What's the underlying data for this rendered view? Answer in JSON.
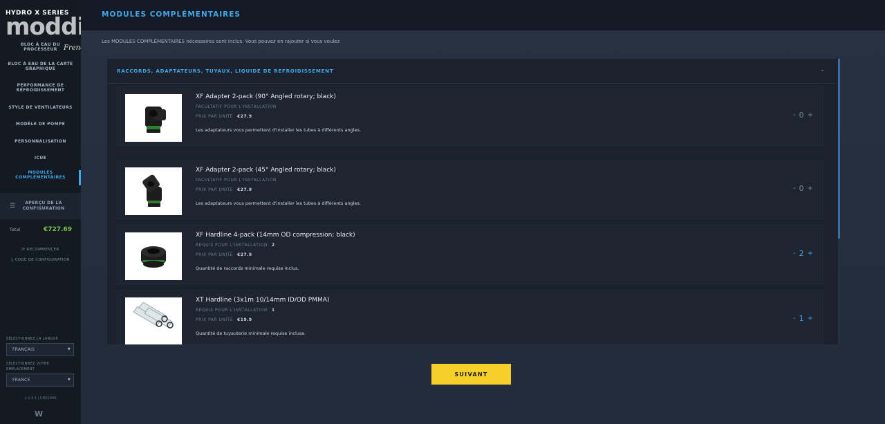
{
  "brand": {
    "name": "HYDRO X SERIES",
    "watermark": "modding.fr",
    "watermark_sub": "French touch"
  },
  "sidebar": {
    "items": [
      {
        "label": "BLOC À EAU DU PROCESSEUR"
      },
      {
        "label": "BLOC À EAU DE LA CARTE GRAPHIQUE"
      },
      {
        "label": "PERFORMANCE DE REFROIDISSEMENT"
      },
      {
        "label": "STYLE DE VENTILATEURS"
      },
      {
        "label": "MODÈLE DE POMPE"
      },
      {
        "label": "PERSONNALISATION"
      },
      {
        "label": "ICUE"
      },
      {
        "label": "MODULES COMPLÉMENTAIRES"
      }
    ],
    "overview_label": "APERÇU DE LA CONFIGURATION",
    "total_label": "Total",
    "total_value": "€727.69",
    "restart_label": "RECOMMENCER",
    "config_code_label": "CODE DE CONFIGURATION",
    "language_label": "SÉLECTIONNEZ LA LANGUE",
    "language_value": "FRANÇAIS",
    "location_label": "SÉLECTIONNEZ VOTRE EMPLACEMENT",
    "location_value": "FRANCE",
    "version": "v 1.3.1 | CHX1930"
  },
  "header": {
    "title": "MODULES COMPLÉMENTAIRES"
  },
  "main": {
    "intro": "Les MODULES COMPLÉMENTAIRES nécessaires sont inclus. Vous pouvez en rajouter si vous voulez",
    "panel_title": "RACCORDS, ADAPTATEURS, TUYAUX, LIQUIDE DE REFROIDISSEMENT",
    "products": [
      {
        "name": "XF Adapter 2-pack (90° Angled rotary; black)",
        "requirement": "FACULTATIF POUR L'INSTALLATION",
        "requirement_count": "",
        "price_label": "PRIX PAR UNITÉ",
        "price": "€27.9",
        "description": "Les adaptateurs vous permettent d'installer les tubes à différents angles.",
        "qty": "0",
        "required": false,
        "icon": "adapter-90-icon"
      },
      {
        "name": "XF Adapter 2-pack (45° Angled rotary; black)",
        "requirement": "FACULTATIF POUR L'INSTALLATION",
        "requirement_count": "",
        "price_label": "PRIX PAR UNITÉ",
        "price": "€27.9",
        "description": "Les adaptateurs vous permettent d'installer les tubes à différents angles.",
        "qty": "0",
        "required": false,
        "icon": "adapter-45-icon"
      },
      {
        "name": "XF Hardline 4-pack (14mm OD compression; black)",
        "requirement": "REQUIS POUR L'INSTALLATION",
        "requirement_count": "2",
        "price_label": "PRIX PAR UNITÉ",
        "price": "€27.9",
        "description": "Quantité de raccords minimale requise inclus.",
        "qty": "2",
        "required": true,
        "icon": "compression-fitting-icon"
      },
      {
        "name": "XT Hardline (3x1m 10/14mm ID/OD PMMA)",
        "requirement": "REQUIS POUR L'INSTALLATION",
        "requirement_count": "1",
        "price_label": "PRIX PAR UNITÉ",
        "price": "€19.9",
        "description": "Quantité de tuyauterie minimale requise incluse.",
        "qty": "1",
        "required": true,
        "icon": "hardline-tube-icon"
      }
    ],
    "next_label": "SUIVANT"
  },
  "colors": {
    "accent": "#43a5ea",
    "button": "#f7cf29",
    "total": "#7ac043"
  }
}
